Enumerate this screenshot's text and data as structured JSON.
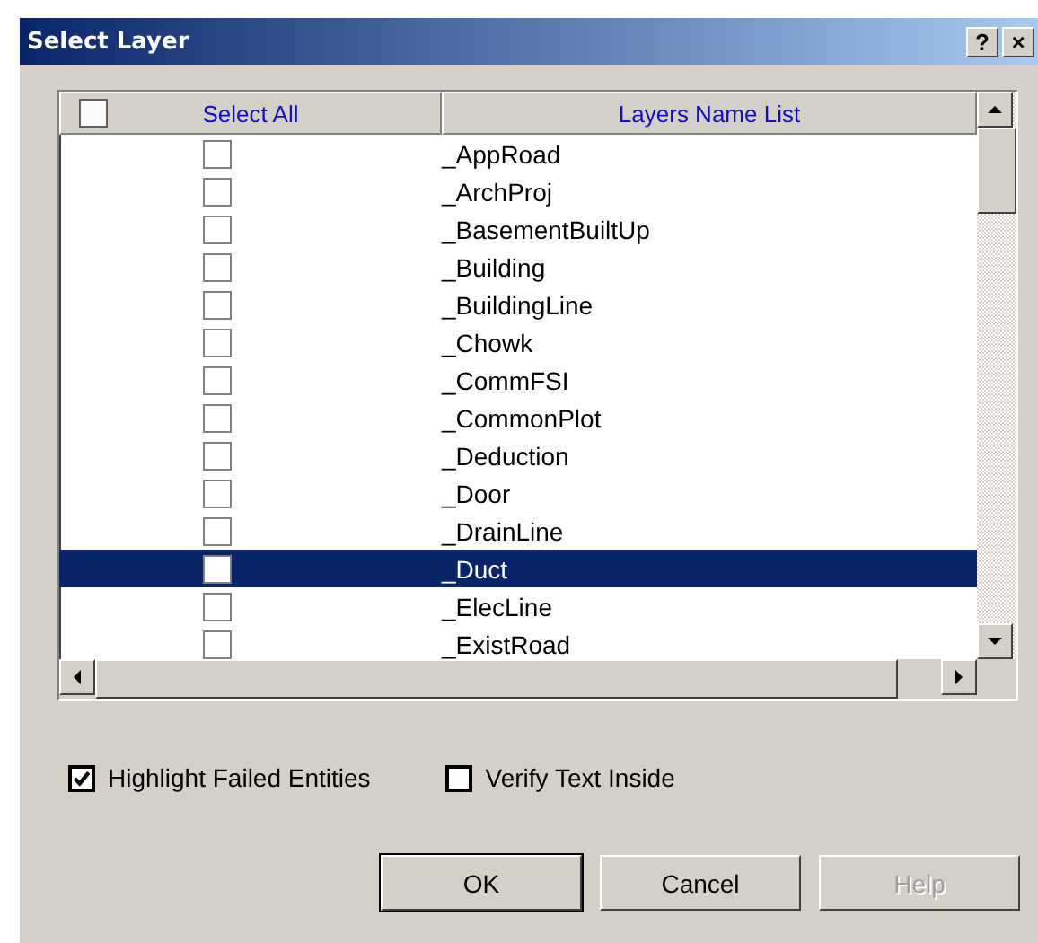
{
  "window": {
    "title": "Select Layer",
    "help_button": "?",
    "close_button": "×"
  },
  "list": {
    "columns": [
      {
        "label": "Select All",
        "checked": false
      },
      {
        "label": "Layers Name List"
      }
    ],
    "rows": [
      {
        "name": "_AppRoad",
        "checked": false,
        "selected": false
      },
      {
        "name": "_ArchProj",
        "checked": false,
        "selected": false
      },
      {
        "name": "_BasementBuiltUp",
        "checked": false,
        "selected": false
      },
      {
        "name": "_Building",
        "checked": false,
        "selected": false
      },
      {
        "name": "_BuildingLine",
        "checked": false,
        "selected": false
      },
      {
        "name": "_Chowk",
        "checked": false,
        "selected": false
      },
      {
        "name": "_CommFSI",
        "checked": false,
        "selected": false
      },
      {
        "name": "_CommonPlot",
        "checked": false,
        "selected": false
      },
      {
        "name": "_Deduction",
        "checked": false,
        "selected": false
      },
      {
        "name": "_Door",
        "checked": false,
        "selected": false
      },
      {
        "name": "_DrainLine",
        "checked": false,
        "selected": false
      },
      {
        "name": "_Duct",
        "checked": false,
        "selected": true
      },
      {
        "name": "_ElecLine",
        "checked": false,
        "selected": false
      },
      {
        "name": "_ExistRoad",
        "checked": false,
        "selected": false
      }
    ]
  },
  "options": [
    {
      "label": "Highlight Failed Entities",
      "checked": true
    },
    {
      "label": "Verify Text Inside",
      "checked": false
    }
  ],
  "buttons": [
    {
      "label": "OK",
      "default": true,
      "disabled": false
    },
    {
      "label": "Cancel",
      "default": false,
      "disabled": false
    },
    {
      "label": "Help",
      "default": false,
      "disabled": true
    }
  ]
}
